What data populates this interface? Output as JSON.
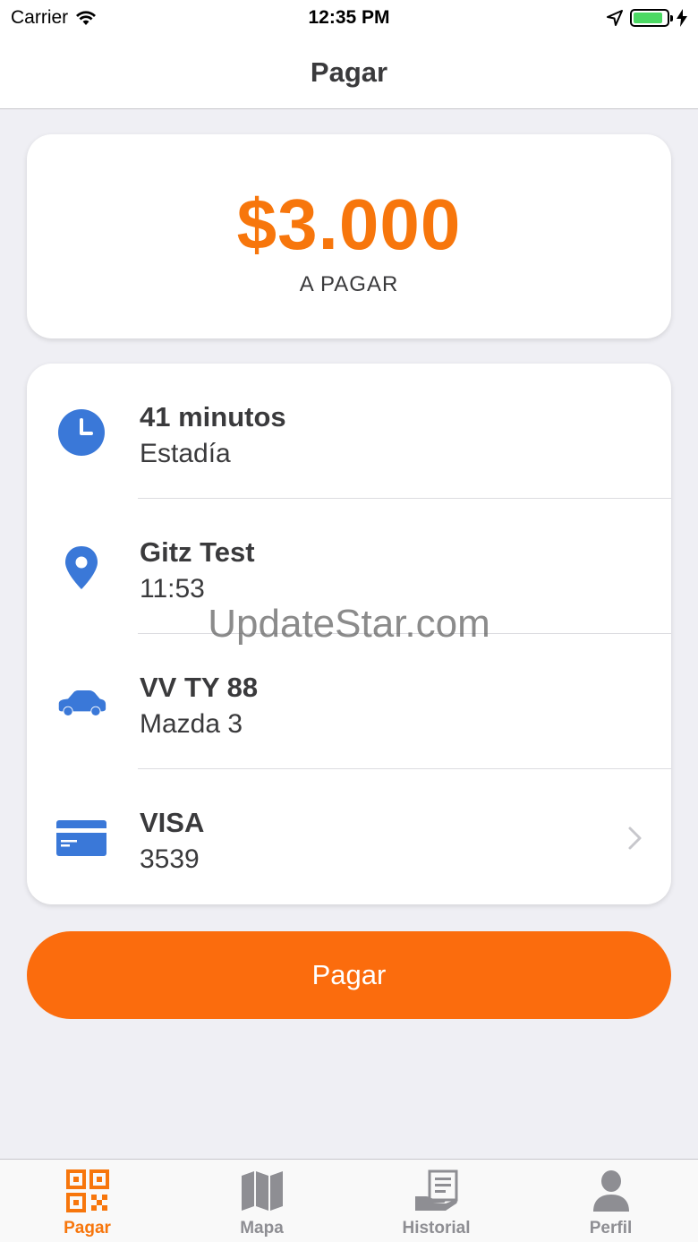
{
  "status_bar": {
    "carrier": "Carrier",
    "time": "12:35 PM",
    "battery_level": 0.9
  },
  "nav": {
    "title": "Pagar"
  },
  "amount": {
    "value": "$3.000",
    "caption": "A PAGAR"
  },
  "details": [
    {
      "icon": "clock-icon",
      "primary": "41 minutos",
      "secondary": "Estadía"
    },
    {
      "icon": "location-pin-icon",
      "primary": "Gitz Test",
      "secondary": "11:53"
    },
    {
      "icon": "car-icon",
      "primary": "VV TY 88",
      "secondary": "Mazda 3"
    },
    {
      "icon": "credit-card-icon",
      "primary": "VISA",
      "secondary": "3539"
    }
  ],
  "watermark": "UpdateStar.com",
  "pay_button": {
    "label": "Pagar"
  },
  "tabs": [
    {
      "icon": "qr-code-icon",
      "label": "Pagar",
      "active": true
    },
    {
      "icon": "map-icon",
      "label": "Mapa",
      "active": false
    },
    {
      "icon": "receipt-icon",
      "label": "Historial",
      "active": false
    },
    {
      "icon": "user-icon",
      "label": "Perfil",
      "active": false
    }
  ],
  "colors": {
    "accent": "#f7760c",
    "button": "#fb6c0d",
    "icon_blue": "#3a78d8",
    "tab_inactive": "#8e8e93"
  }
}
